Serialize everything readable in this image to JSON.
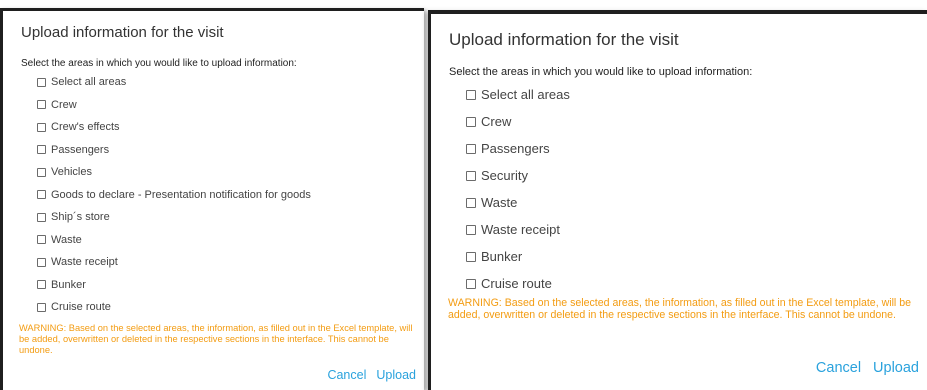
{
  "colors": {
    "accent": "#2aa2dd",
    "warning": "#f39c12",
    "title": "#333333"
  },
  "left_dialog": {
    "title": "Upload information for the visit",
    "subtitle": "Select the areas in which you would like to upload information:",
    "areas": [
      {
        "label": "Select all areas",
        "checked": false
      },
      {
        "label": "Crew",
        "checked": false
      },
      {
        "label": "Crew's effects",
        "checked": false
      },
      {
        "label": "Passengers",
        "checked": false
      },
      {
        "label": "Vehicles",
        "checked": false
      },
      {
        "label": "Goods to declare - Presentation notification for goods",
        "checked": false
      },
      {
        "label": "Ship´s store",
        "checked": false
      },
      {
        "label": "Waste",
        "checked": false
      },
      {
        "label": "Waste receipt",
        "checked": false
      },
      {
        "label": "Bunker",
        "checked": false
      },
      {
        "label": "Cruise route",
        "checked": false
      }
    ],
    "warning": "WARNING: Based on the selected areas, the information, as filled out in the Excel template, will be added, overwritten or deleted in the respective sections in the interface. This cannot be undone.",
    "cancel_label": "Cancel",
    "upload_label": "Upload"
  },
  "right_dialog": {
    "title": "Upload information for the visit",
    "subtitle": "Select the areas in which you would like to upload information:",
    "areas": [
      {
        "label": "Select all areas",
        "checked": false
      },
      {
        "label": "Crew",
        "checked": false
      },
      {
        "label": "Passengers",
        "checked": false
      },
      {
        "label": "Security",
        "checked": false
      },
      {
        "label": "Waste",
        "checked": false
      },
      {
        "label": "Waste receipt",
        "checked": false
      },
      {
        "label": "Bunker",
        "checked": false
      },
      {
        "label": "Cruise route",
        "checked": false
      }
    ],
    "warning": "WARNING: Based on the selected areas, the information, as filled out in the Excel template, will be added, overwritten or deleted in the respective sections in the interface. This cannot be undone.",
    "cancel_label": "Cancel",
    "upload_label": "Upload"
  }
}
